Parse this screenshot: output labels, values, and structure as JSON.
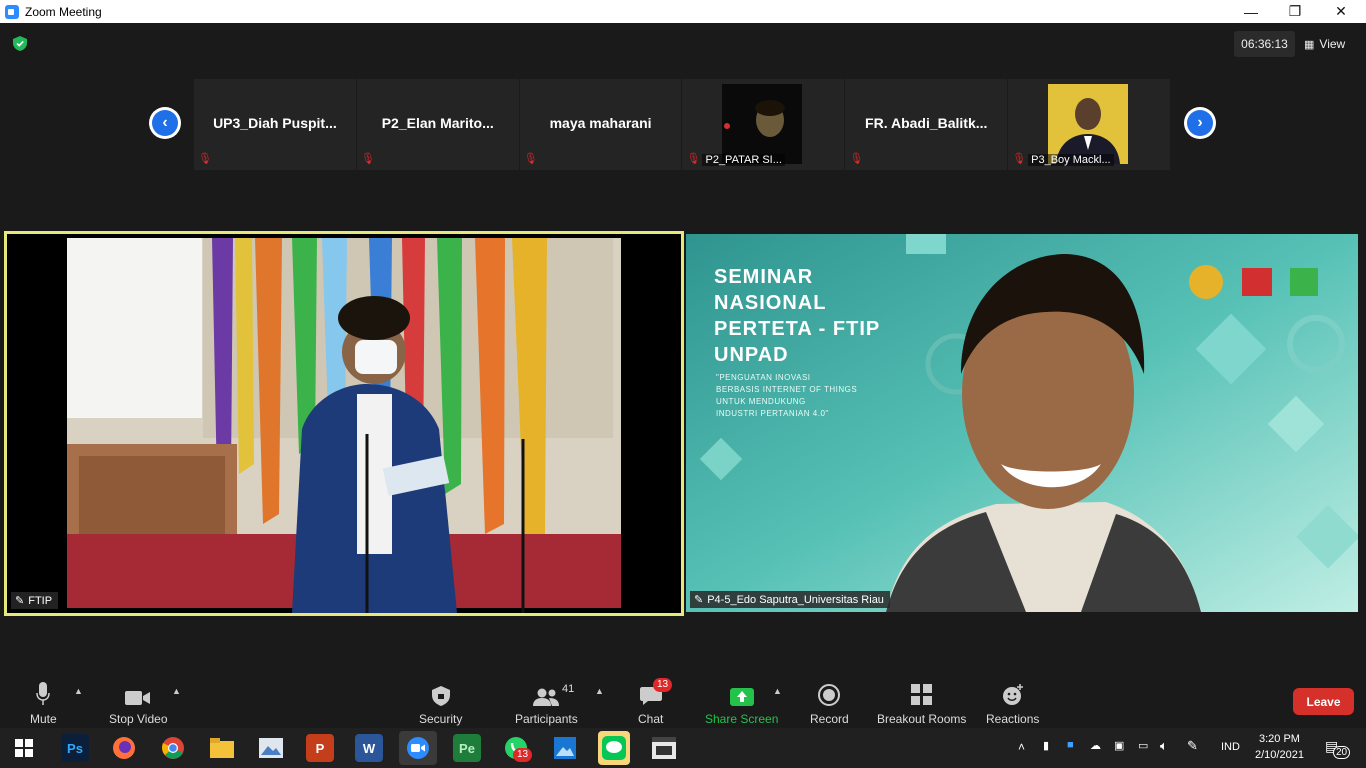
{
  "window": {
    "title": "Zoom Meeting"
  },
  "header": {
    "timer": "06:36:13",
    "view_label": "View"
  },
  "strip": {
    "participants": [
      {
        "name": "UP3_Diah  Puspit...",
        "video": false,
        "video_label": ""
      },
      {
        "name": "P2_Elan  Marito...",
        "video": false,
        "video_label": ""
      },
      {
        "name": "maya maharani",
        "video": false,
        "video_label": ""
      },
      {
        "name": "",
        "video": true,
        "video_label": "P2_PATAR SI..."
      },
      {
        "name": "FR.  Abadi_Balitk...",
        "video": false,
        "video_label": ""
      },
      {
        "name": "",
        "video": true,
        "video_label": "P3_Boy Mackl..."
      }
    ]
  },
  "main": {
    "left_video_label": "FTIP",
    "right_video_label": "P4-5_Edo Saputra_Universitas Riau",
    "slide": {
      "line1": "SEMINAR",
      "line2": "NASIONAL",
      "line3": "PERTETA - FTIP",
      "line4": "UNPAD",
      "sub1": "\"PENGUATAN INOVASI",
      "sub2": "BERBASIS INTERNET OF THINGS",
      "sub3": "UNTUK MENDUKUNG",
      "sub4": "INDUSTRI PERTANIAN 4.0\""
    }
  },
  "toolbar": {
    "mute": "Mute",
    "stop_video": "Stop Video",
    "security": "Security",
    "participants": "Participants",
    "participants_count": "41",
    "chat": "Chat",
    "chat_badge": "13",
    "share_screen": "Share Screen",
    "record": "Record",
    "breakout_rooms": "Breakout Rooms",
    "reactions": "Reactions",
    "leave": "Leave"
  },
  "taskbar": {
    "apps": [
      "windows-start",
      "photoshop",
      "firefox",
      "chrome",
      "file-explorer",
      "photo-viewer",
      "powerpoint",
      "word",
      "zoom",
      "pe-app",
      "whatsapp",
      "photos",
      "line",
      "video-editor"
    ],
    "whatsapp_badge": "13",
    "lang": "IND",
    "time": "3:20 PM",
    "date": "2/10/2021",
    "notification_count": "20"
  },
  "colors": {
    "accent": "#2d8cff",
    "leave": "#d5302a",
    "share": "#24c24a",
    "active_border": "#e6e97a",
    "slide_bg": "#3fa9a4"
  }
}
